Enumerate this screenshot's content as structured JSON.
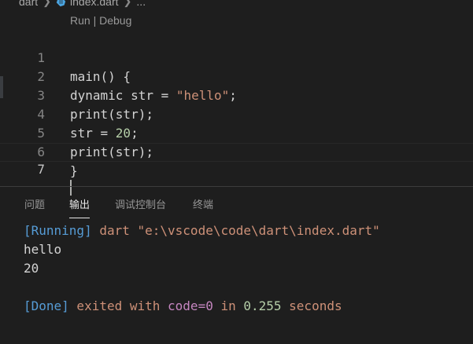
{
  "breadcrumb": {
    "folder": "dart",
    "file": "index.dart",
    "more": "..."
  },
  "codelens": {
    "run": "Run",
    "separator": " | ",
    "debug": "Debug"
  },
  "editor": {
    "lines": [
      {
        "n": "1",
        "text": "main() {"
      },
      {
        "n": "2",
        "pre": "dynamic str = ",
        "str": "\"hello\"",
        "post": ";"
      },
      {
        "n": "3",
        "text": "print(str);"
      },
      {
        "n": "4",
        "pre": "str = ",
        "num": "20",
        "post": ";"
      },
      {
        "n": "5",
        "text": "print(str);"
      },
      {
        "n": "6",
        "text": "}"
      },
      {
        "n": "7",
        "text": ""
      }
    ]
  },
  "panel": {
    "tabs": [
      "问题",
      "输出",
      "调试控制台",
      "终端"
    ],
    "active_tab": "输出"
  },
  "output": {
    "running_tag": "[Running]",
    "running_cmd": " dart \"e:\\vscode\\code\\dart\\index.dart\"",
    "line1": "hello",
    "line2": "20",
    "done_tag": "[Done]",
    "done_a": " exited with ",
    "done_code": "code=0",
    "done_b": " in ",
    "done_time": "0.255",
    "done_c": " seconds"
  },
  "colors": {
    "background": "#1e1e1e",
    "keyword_blue": "#569cd6",
    "string_orange": "#ce9178",
    "number_green": "#b5cea8",
    "code_purple": "#c586c0"
  },
  "icons": {
    "file_icon": "dart-file-icon",
    "chevron": "chevron-right-icon"
  }
}
